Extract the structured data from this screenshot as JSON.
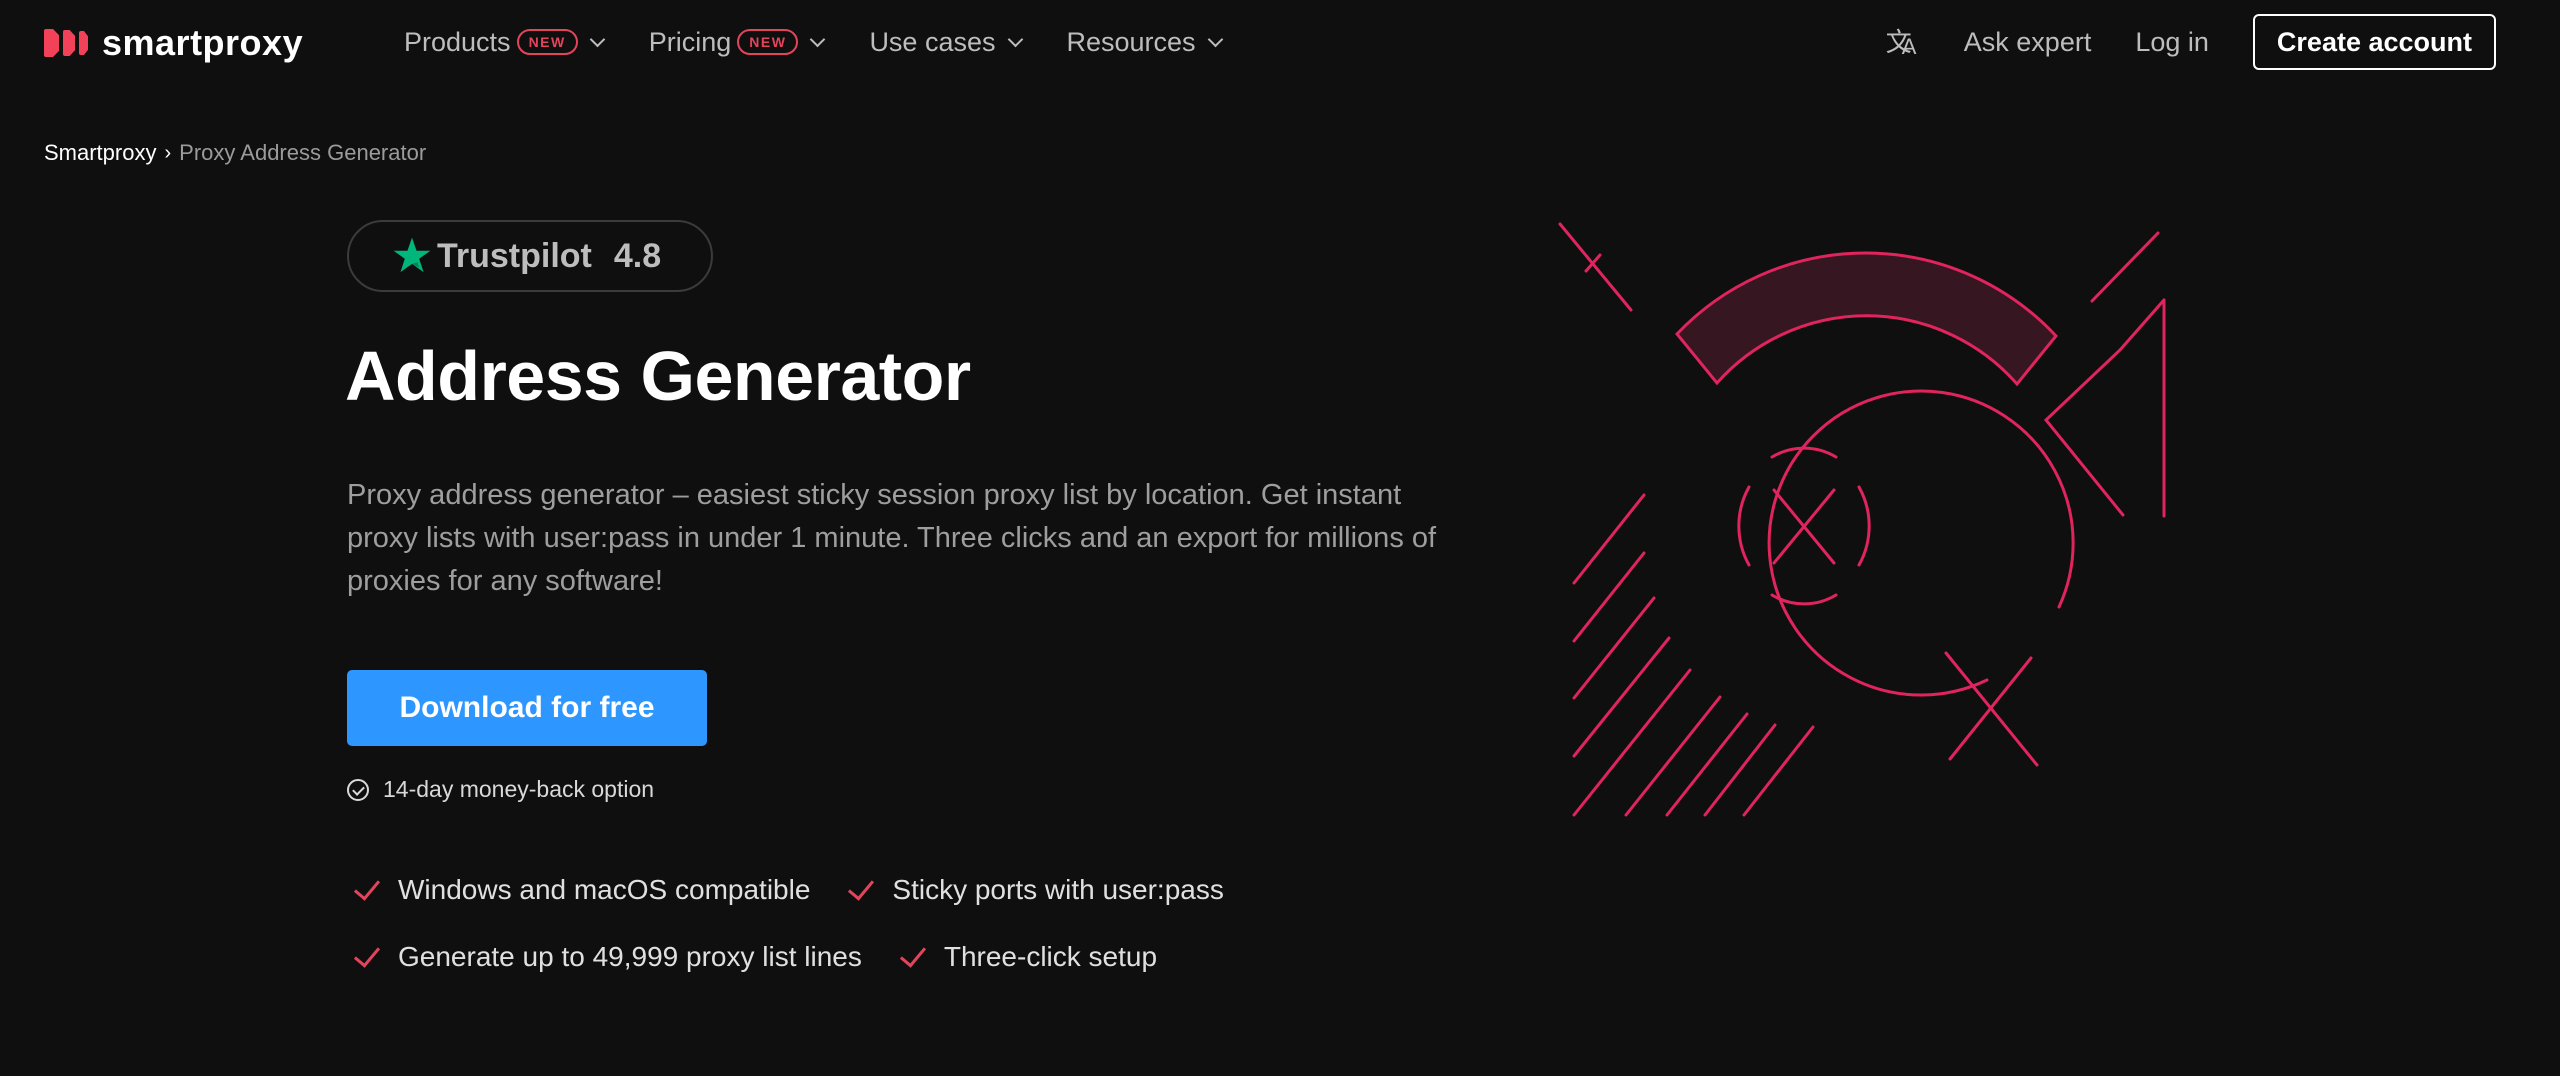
{
  "nav": {
    "logo_text": "smartproxy",
    "menu": [
      {
        "label": "Products",
        "badge": "NEW"
      },
      {
        "label": "Pricing",
        "badge": "NEW"
      },
      {
        "label": "Use cases",
        "badge": null
      },
      {
        "label": "Resources",
        "badge": null
      }
    ],
    "translate_icon": "translate-icon",
    "ask_expert": "Ask expert",
    "login": "Log in",
    "create_account": "Create account"
  },
  "breadcrumb": {
    "home": "Smartproxy",
    "separator": "›",
    "current": "Proxy Address Generator"
  },
  "hero": {
    "trustpilot": {
      "name": "Trustpilot",
      "score": "4.8",
      "star_color": "#00b67a"
    },
    "title": "Address Generator",
    "description": "Proxy address generator – easiest sticky session proxy list by location. Get instant proxy lists with user:pass in under 1 minute. Three clicks and an export for millions of proxies for any software!",
    "cta": "Download for free",
    "guarantee": "14-day money-back option",
    "features": [
      "Windows and macOS compatible",
      "Sticky ports with user:pass",
      "Generate up to 49,999 proxy list lines",
      "Three-click setup"
    ]
  },
  "colors": {
    "background": "#0f0f10",
    "accent": "#e2445c",
    "illustration": "#e0245e",
    "cta": "#2d96ff"
  }
}
